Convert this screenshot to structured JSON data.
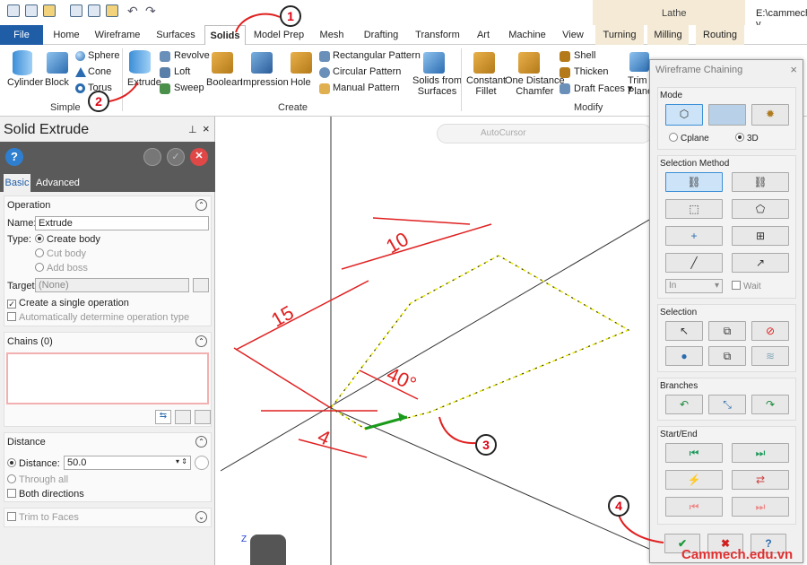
{
  "quick_access": {
    "icons": [
      "new-file-icon",
      "save-icon",
      "open-icon",
      "print-icon",
      "save-as-icon",
      "merge-icon",
      "undo-icon",
      "redo-icon"
    ]
  },
  "context_tab_header": "Lathe",
  "file_path": "E:\\cammech v",
  "tabs": [
    "File",
    "Home",
    "Wireframe",
    "Surfaces",
    "Solids",
    "Model Prep",
    "Mesh",
    "Drafting",
    "Transform",
    "Art",
    "Machine",
    "View",
    "Turning",
    "Milling",
    "Routing"
  ],
  "active_tab": "Solids",
  "ribbon": {
    "simple": {
      "group": "Simple",
      "cylinder": "Cylinder",
      "block": "Block",
      "sphere": "Sphere",
      "cone": "Cone",
      "torus": "Torus"
    },
    "create": {
      "group": "Create",
      "extrude": "Extrude",
      "revolve": "Revolve",
      "loft": "Loft",
      "sweep": "Sweep",
      "boolean": "Boolean",
      "impression": "Impression",
      "hole": "Hole",
      "rect_pattern": "Rectangular Pattern",
      "circ_pattern": "Circular Pattern",
      "manual_pattern": "Manual Pattern",
      "solids_from_surfaces": [
        "Solids from",
        "Surfaces"
      ]
    },
    "modify": {
      "group": "Modify",
      "constant_fillet": [
        "Constant",
        "Fillet"
      ],
      "one_distance_chamfer": [
        "One Distance",
        "Chamfer"
      ],
      "shell": "Shell",
      "thicken": "Thicken",
      "draft_faces": "Draft Faces",
      "trim": [
        "Trim t",
        "Plane"
      ]
    }
  },
  "panel": {
    "title": "Solid Extrude",
    "pin": "p",
    "close": "×",
    "tabs": [
      "Basic",
      "Advanced"
    ],
    "operation": {
      "header": "Operation",
      "name_label": "Name:",
      "name_value": "Extrude",
      "type_label": "Type:",
      "create_body": "Create body",
      "cut_body": "Cut body",
      "add_boss": "Add boss",
      "target_label": "Target:",
      "target_value": "(None)",
      "single_op": "Create a single operation",
      "auto_type": "Automatically determine operation type"
    },
    "chains": {
      "header": "Chains (0)"
    },
    "distance": {
      "header": "Distance",
      "distance_label": "Distance:",
      "distance_value": "50.0",
      "through_all": "Through all",
      "both_directions": "Both directions"
    },
    "trim": {
      "header": "Trim to Faces"
    }
  },
  "canvas": {
    "autocursor": "AutoCursor",
    "dims": {
      "d10": "10",
      "d15": "15",
      "d40": "40°",
      "d4": "4"
    },
    "axis_z": "Z"
  },
  "chaining": {
    "title": "Wireframe Chaining",
    "mode": "Mode",
    "cplane": "Cplane",
    "three_d": "3D",
    "selection_method": "Selection Method",
    "in_value": "In",
    "wait": "Wait",
    "selection": "Selection",
    "branches": "Branches",
    "start_end": "Start/End"
  },
  "callouts": [
    "1",
    "2",
    "3",
    "4"
  ],
  "watermark": "Cammech.edu.vn"
}
